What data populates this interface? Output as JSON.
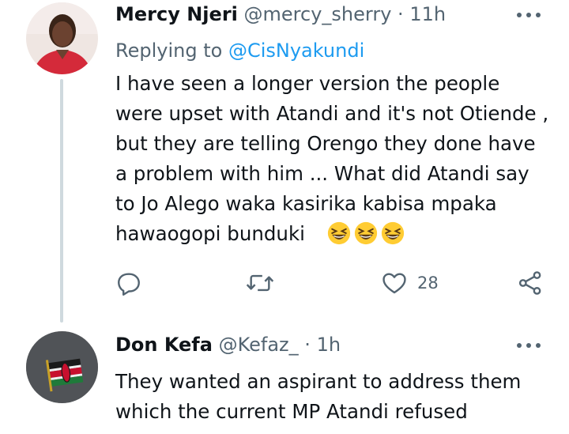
{
  "tweets": [
    {
      "name": "Mercy Njeri",
      "handle": "@mercy_sherry",
      "separator": "·",
      "time": "11h",
      "replying_prefix": "Replying to",
      "replying_mention": "@CisNyakundi",
      "text_lines": [
        "I have seen a longer version the people",
        "were upset with Atandi and it's not Otiende ,",
        "but they are telling Orengo they done have",
        "a problem with him ... What did Atandi say",
        "to Jo Alego waka kasirika kabisa mpaka",
        "hawaogopi bunduki"
      ],
      "emojis": [
        "grinning-squinting-face",
        "grinning-squinting-face",
        "grinning-squinting-face"
      ],
      "actions": {
        "reply_icon": "reply-icon",
        "retweet_icon": "retweet-icon",
        "like_icon": "heart-icon",
        "like_count": "28",
        "share_icon": "share-icon"
      }
    },
    {
      "name": "Don Kefa",
      "handle": "@Kefaz_",
      "separator": "·",
      "time": "1h",
      "text_lines": [
        "They wanted an aspirant to address them",
        "which the current MP Atandi refused"
      ]
    }
  ],
  "colors": {
    "secondary_text": "#536471",
    "link": "#1d9bf0",
    "primary_text": "#0f1419",
    "thread_line": "#cfd9de"
  }
}
